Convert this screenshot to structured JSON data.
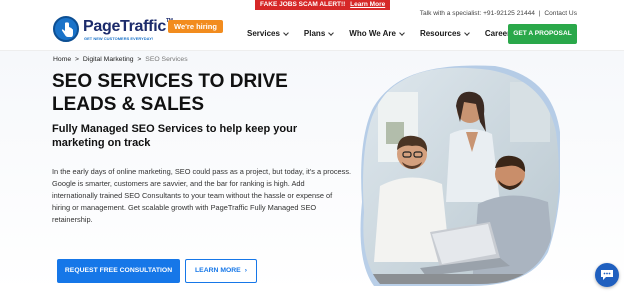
{
  "topbar": {
    "alert_text": "FAKE JOBS SCAM ALERT!!",
    "alert_link": "Learn More",
    "contact_text": "Talk with a specialist: +91-92125 21444",
    "contact_sep": "|",
    "contact_link": "Contact Us"
  },
  "header": {
    "logo_name": "PageTraffic",
    "logo_tm": "TM",
    "logo_tagline": "GET NEW CUSTOMERS EVERYDAY!",
    "hiring_badge": "We're hiring",
    "nav": [
      {
        "label": "Services"
      },
      {
        "label": "Plans"
      },
      {
        "label": "Who We Are"
      },
      {
        "label": "Resources"
      },
      {
        "label": "Career"
      }
    ],
    "cta": "GET A PROPOSAL"
  },
  "breadcrumb": {
    "items": [
      "Home",
      "Digital Marketing",
      "SEO Services"
    ],
    "sep": ">"
  },
  "hero": {
    "title": "SEO SERVICES TO DRIVE LEADS & SALES",
    "subtitle": "Fully Managed SEO Services to help keep your marketing on track",
    "body": "In the early days of online marketing, SEO could pass as a project, but today, it's a process. Google is smarter, customers are savvier, and the bar for ranking is high. Add internationally trained SEO Consultants to your team without the hassle or expense of hiring or management. Get scalable growth with PageTraffic Fully Managed SEO retainership.",
    "primary_button": "REQUEST FREE CONSULTATION",
    "secondary_button": "LEARN MORE",
    "secondary_arrow": "›"
  },
  "colors": {
    "brand_blue": "#1677e8",
    "alert_red": "#d62828",
    "hiring_orange": "#f28c1e",
    "cta_green": "#2aa84a"
  },
  "icons": {
    "logo": "hand-cursor-icon",
    "chat": "chat-bubble-icon"
  }
}
